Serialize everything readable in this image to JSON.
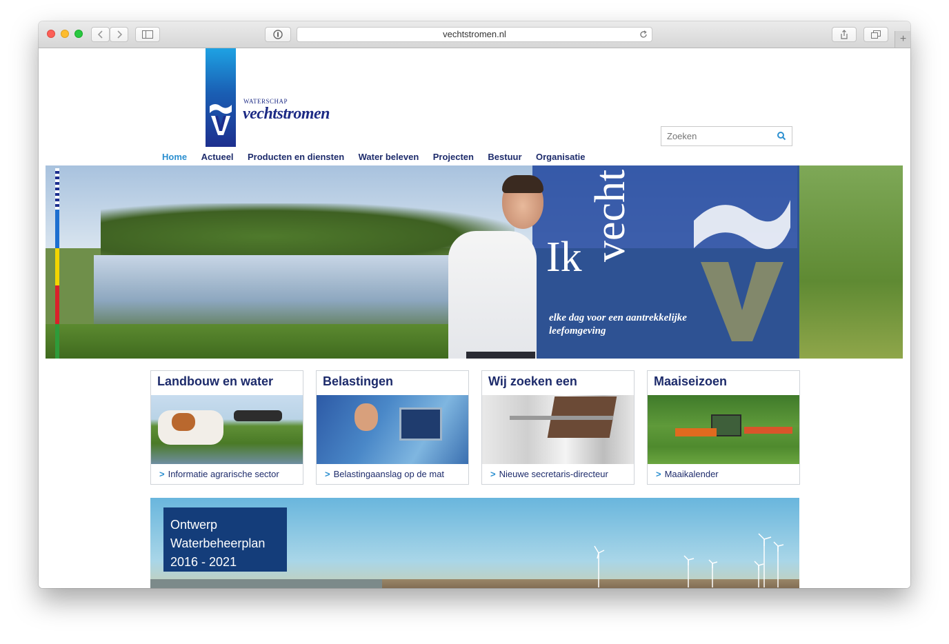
{
  "browser": {
    "url": "vechtstromen.nl",
    "back_icon": "chevron-left-icon",
    "forward_icon": "chevron-right-icon",
    "sidebar_icon": "sidebar-icon",
    "reader_icon": "reader-icon",
    "reload_icon": "reload-icon",
    "share_icon": "share-icon",
    "tabs_icon": "tabs-icon",
    "new_tab_icon": "plus-icon"
  },
  "header": {
    "logo_small": "WATERSCHAP",
    "logo_big": "vechtstromen",
    "search_placeholder": "Zoeken"
  },
  "nav": {
    "items": [
      "Home",
      "Actueel",
      "Producten en diensten",
      "Water beleven",
      "Projecten",
      "Bestuur",
      "Organisatie"
    ],
    "active": "Home"
  },
  "hero": {
    "line1": "Ik",
    "line2": "vecht",
    "tagline": "elke dag voor een aantrekkelijke leefomgeving",
    "stripe_colors": [
      "#1d6fd0",
      "#f2d500",
      "#d8222a",
      "#2e9b3a"
    ]
  },
  "cards": [
    {
      "title": "Landbouw en water",
      "link": "Informatie agrarische sector"
    },
    {
      "title": "Belastingen",
      "link": "Belastingaanslag op de mat"
    },
    {
      "title": "Wij zoeken een",
      "link": "Nieuwe secretaris-directeur"
    },
    {
      "title": "Maaiseizoen",
      "link": "Maaikalender"
    }
  ],
  "banner": {
    "line1": "Ontwerp",
    "line2": "Waterbeheerplan",
    "line3": "2016 - 2021"
  },
  "colors": {
    "brand_navy": "#1d2b6b",
    "accent_blue": "#2b8fd0"
  }
}
